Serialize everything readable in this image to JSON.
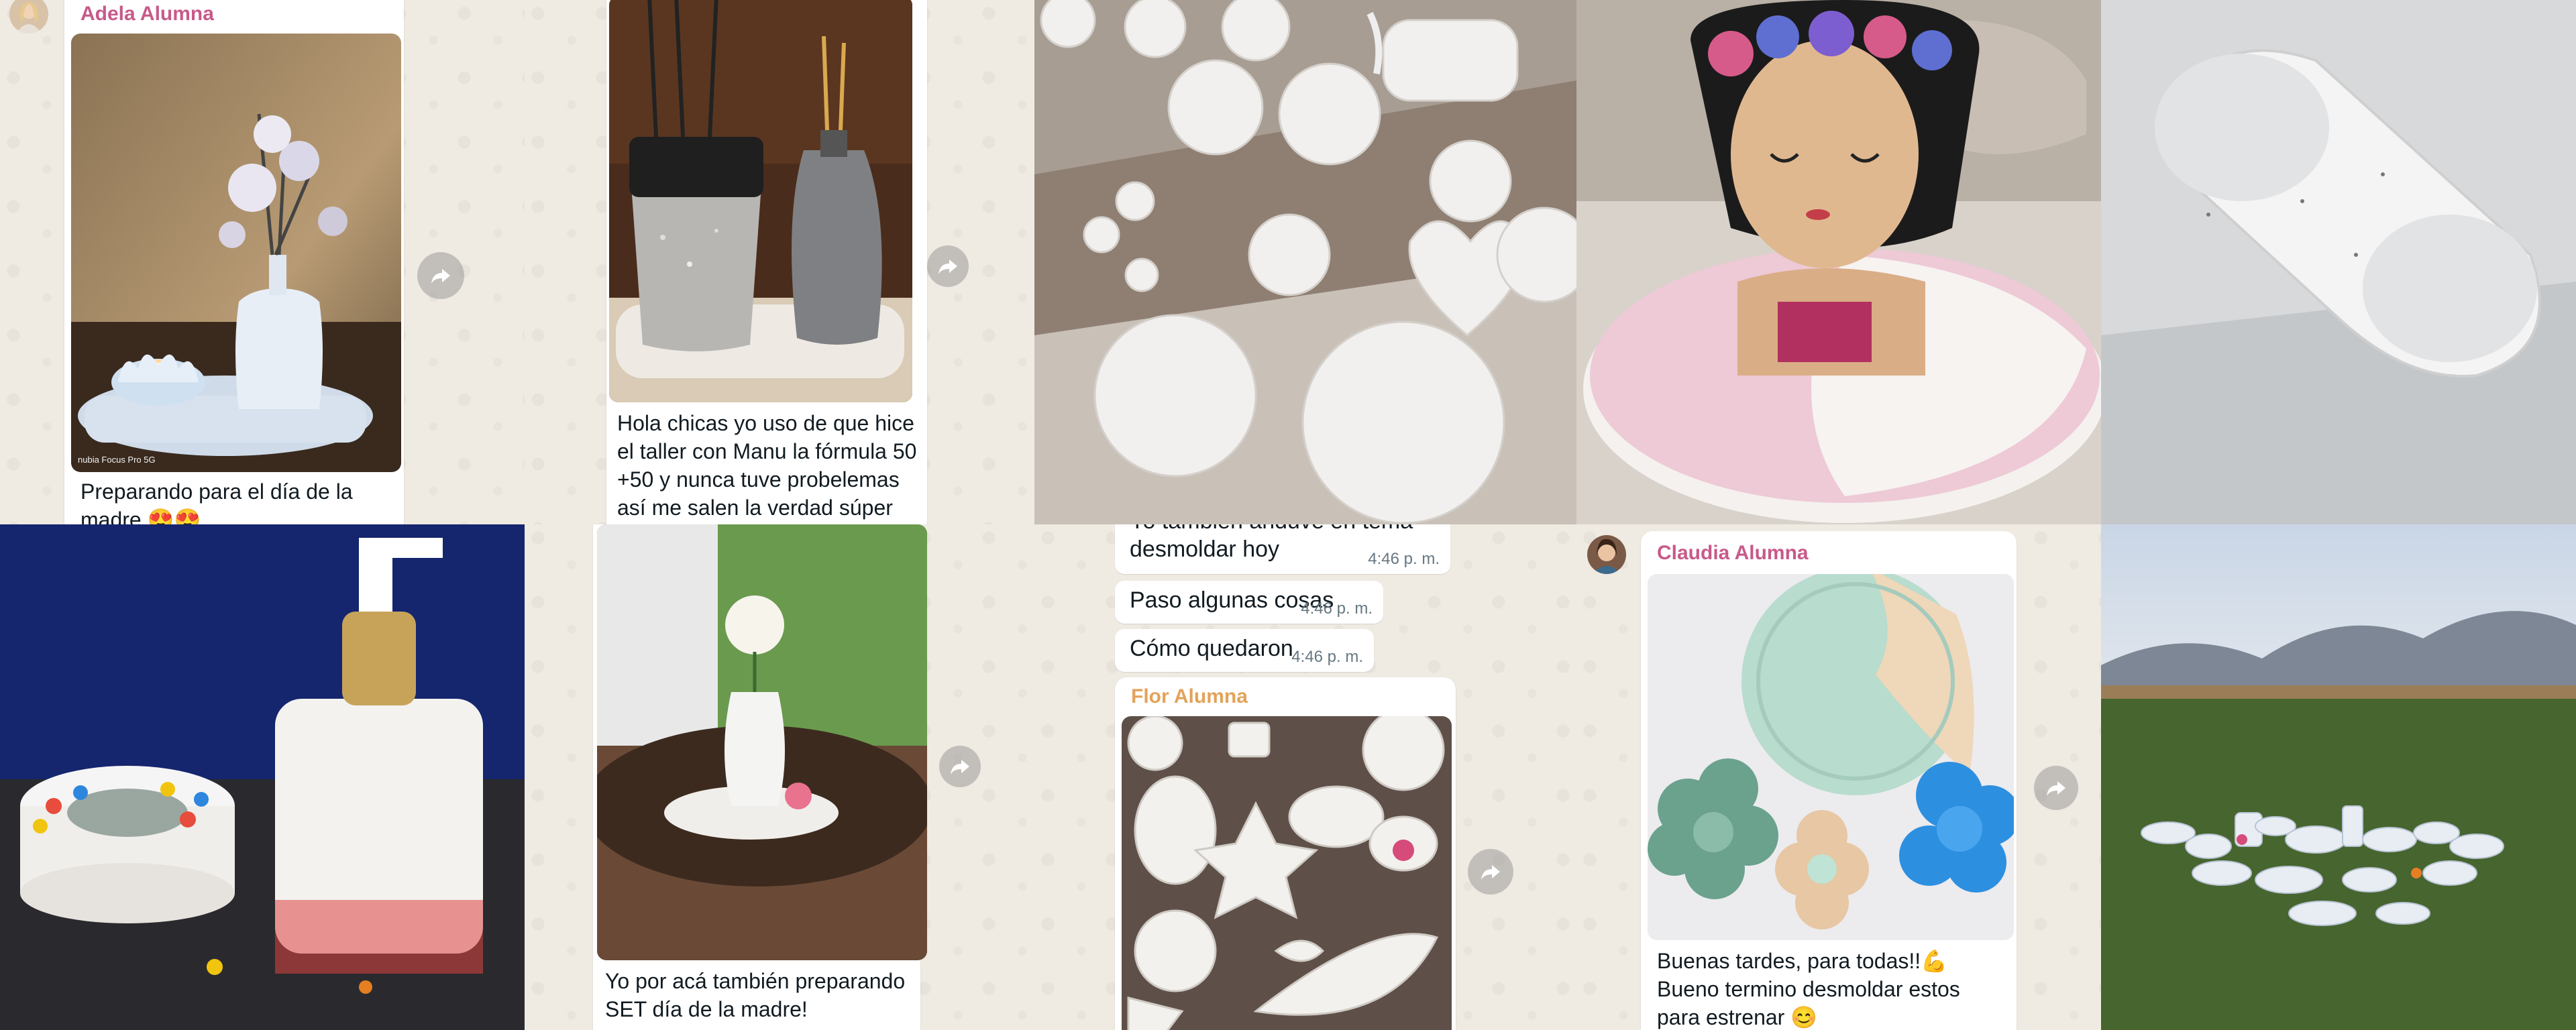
{
  "tiles": {
    "t1": {
      "sender": "Adela Alumna",
      "sender_color": "#c75a8a",
      "photo_watermark": "nubia Focus Pro 5G",
      "caption": "Preparando para el día de la madre 😍😍",
      "photo_desc_icon": "diffuser-and-candle-tray-photo"
    },
    "t2": {
      "caption": "Hola chicas yo uso de que hice el taller con Manu la fórmula 50 +50 y nunca tuve probelemas así me salen la verdad súper conforme estoy"
    },
    "t3": {
      "photo_desc_icon": "plaster-pieces-collection-photo"
    },
    "t4": {
      "photo_desc_icon": "frida-bust-planter-photo"
    },
    "t5": {
      "photo_desc_icon": "double-candle-holder-photo"
    },
    "t6": {
      "photo_desc_icon": "soap-dispenser-and-succulent-photo"
    },
    "t7": {
      "caption": "Yo por acá también preparando SET día de la madre!"
    },
    "t8": {
      "messages": [
        {
          "text": "Yo también anduve en tema desmoldar hoy",
          "time": "4:46 p. m."
        },
        {
          "text": "Paso algunas cosas",
          "time": "4:46 p. m."
        },
        {
          "text": "Cómo quedaron",
          "time": "4:46 p. m."
        }
      ],
      "sender": "Flor Alumna",
      "sender_color": "#e3a35a"
    },
    "t9": {
      "sender": "Claudia Alumna",
      "sender_color": "#c75a8a",
      "caption_line1": "Buenas tardes, para todas!!💪",
      "caption_line2": "Bueno termino desmoldar estos para estrenar 😊"
    },
    "t10": {
      "photo_desc_icon": "pieces-on-grass-photo"
    }
  },
  "colors": {
    "chat_bg": "#efeae2",
    "bubble": "#ffffff",
    "time": "#667781"
  }
}
